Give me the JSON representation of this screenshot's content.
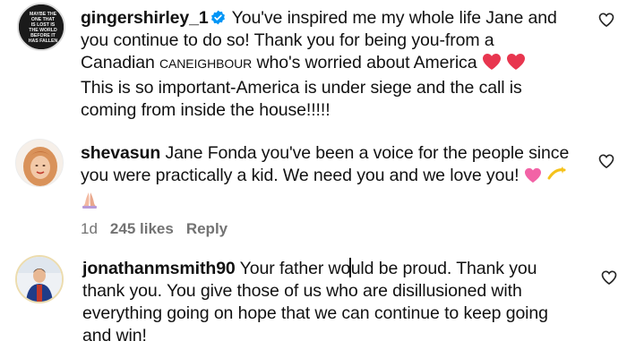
{
  "comments": [
    {
      "username": "gingershirley_1",
      "avatar_text": "MAYBE THE ONE THAT IS LOST IS THE WORLD BEFORE IT HAS FALLEN",
      "lines": [
        "You've inspired me my whole life Jane and",
        "you continue to do so! Thank you for being you-from a",
        "Canadian ",
        "This is so important-America is under siege and the call is",
        "coming from inside the house!!!!!"
      ],
      "smallcaps": "caneighbour",
      "line3_rest": " who's worried about America"
    },
    {
      "username": "shevasun",
      "lines": [
        "Jane Fonda you've been a voice for the people since",
        "you were practically a kid. We need you and we love you!"
      ],
      "time": "1d",
      "likes": "245 likes",
      "reply": "Reply"
    },
    {
      "username": "jonathanmsmith90",
      "lines": [
        "Your father wo",
        "uld be proud. Thank you",
        "thank you. You give those of us who are disillusioned with",
        "everything going on hope that we can continue to keep going",
        "and win!"
      ]
    }
  ],
  "icons": {
    "verified": "verified-badge-icon",
    "like": "heart-outline-icon",
    "emoji_heart": "red-heart-emoji",
    "emoji_pink_heart": "pink-heart-emoji",
    "emoji_dizzy": "dizzy-emoji",
    "emoji_pray": "folded-hands-emoji"
  },
  "colors": {
    "verified_blue": "#0095f6",
    "meta_gray": "#737373",
    "red_heart": "#e8364f"
  }
}
